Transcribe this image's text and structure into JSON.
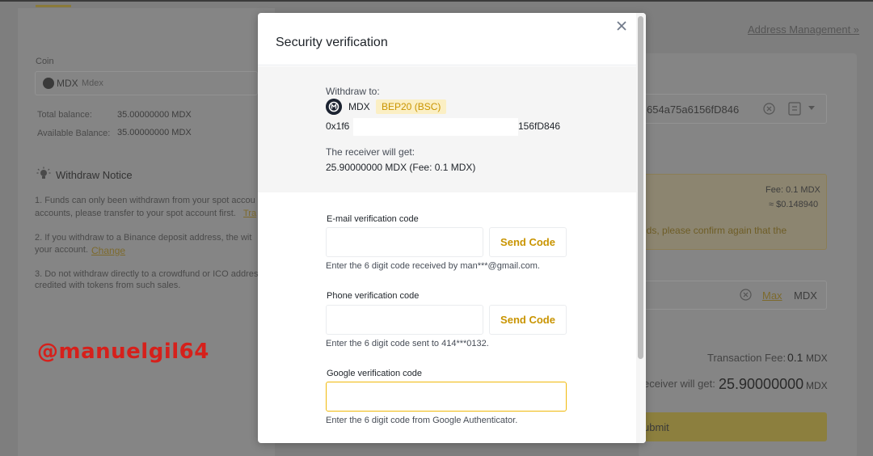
{
  "background": {
    "address_management": "Address Management »",
    "coin_label": "Coin",
    "coin_symbol": "MDX",
    "coin_name": "Mdex",
    "total_balance_label": "Total balance:",
    "total_balance_value": "35.00000000 MDX",
    "available_balance_label": "Available Balance:",
    "available_balance_value": "35.00000000 MDX",
    "notice_title": "Withdraw Notice",
    "notice_1a": "1. Funds can only been withdrawn from your spot accou",
    "notice_1b": "accounts, please transfer to your spot account first.",
    "notice_1_link": "Tra",
    "notice_2a": "2. If you withdraw to a Binance deposit address, the wit",
    "notice_2b": "your account.",
    "notice_2_link": "Change",
    "notice_3a": "3. Do not withdraw directly to a crowdfund or ICO addres",
    "notice_3b": "credited with tokens from such sales.",
    "address_partial": "654a75a6156fD846",
    "fee_label": "Fee: 0.1 MDX",
    "fee_usd": "≈ $0.148940",
    "warning_partial": "nds, please confirm again that the",
    "max_label": "Max",
    "amount_unit": "MDX",
    "colon": ":",
    "tx_fee_label": "Transaction Fee:",
    "tx_fee_value": "0.1",
    "tx_fee_unit": "MDX",
    "receiver_label": "eceiver will get:",
    "receiver_value": "25.90000000",
    "receiver_unit": "MDX",
    "submit_label": "ubmit"
  },
  "watermark": "@manuelgil64",
  "modal": {
    "title": "Security verification",
    "withdraw_to_label": "Withdraw to:",
    "coin": "MDX",
    "network_badge": "BEP20 (BSC)",
    "address_start": "0x1f6",
    "address_end": "156fD846",
    "receiver_label": "The receiver will get:",
    "receiver_value": "25.90000000 MDX (Fee: 0.1 MDX)",
    "email_label": "E-mail verification code",
    "email_hint": "Enter the 6 digit code received by man***@gmail.com.",
    "phone_label": "Phone verification code",
    "phone_hint": "Enter the 6 digit code sent to 414***0132.",
    "google_label": "Google verification code",
    "google_hint": "Enter the 6 digit code from Google Authenticator.",
    "send_code": "Send Code"
  }
}
